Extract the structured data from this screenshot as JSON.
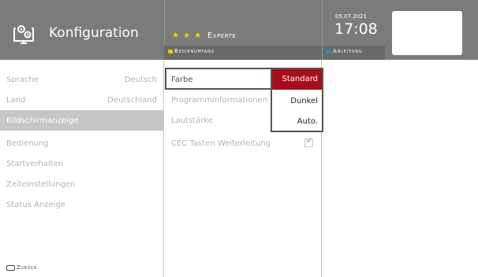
{
  "header": {
    "title": "Konfiguration",
    "icon": "settings-monitor-icon",
    "level": {
      "stars": "★ ★ ★",
      "label": "Experte"
    },
    "scope": {
      "label": "Bedienumfang",
      "chip_color": "#f2d200"
    },
    "help": {
      "label": "Anleitung",
      "chip_color": "#1e8fe0"
    },
    "date": "05.07.2021",
    "time": "17:08"
  },
  "menu": {
    "items": [
      {
        "label": "Sprache",
        "value": "Deutsch"
      },
      {
        "label": "Land",
        "value": "Deutschland"
      },
      {
        "label": "Bildschirmanzeige",
        "value": ""
      },
      {
        "label": "Bedienung",
        "value": ""
      },
      {
        "label": "Startverhalten",
        "value": ""
      },
      {
        "label": "Zeiteinstellungen",
        "value": ""
      },
      {
        "label": "Status Anzeige",
        "value": ""
      }
    ],
    "selected_index": 2
  },
  "options": {
    "rows": [
      {
        "label": "Farbe"
      },
      {
        "label": "Programminformationen"
      },
      {
        "label": "Lautstärke"
      },
      {
        "label": "CEC Tasten Weiterleitung",
        "checked": true
      }
    ]
  },
  "popup": {
    "options": [
      "Standard",
      "Dunkel",
      "Auto."
    ],
    "selected": "Standard",
    "highlight_color": "#a80e1a"
  },
  "footer": {
    "back_label": "Zurück"
  }
}
